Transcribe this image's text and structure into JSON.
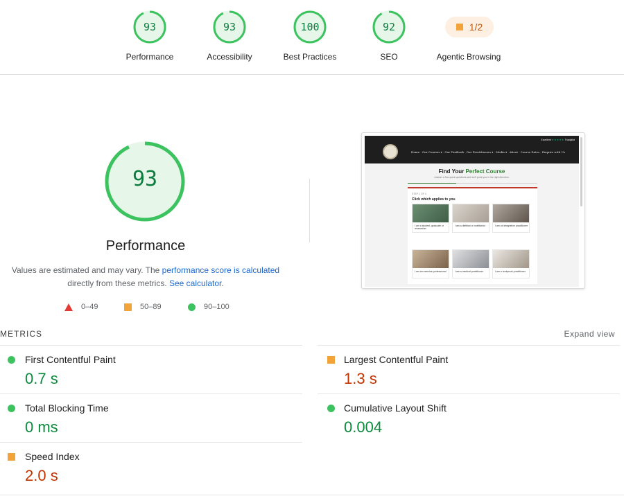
{
  "gauges": [
    {
      "score": "93",
      "label": "Performance",
      "fraction": 0.93
    },
    {
      "score": "93",
      "label": "Accessibility",
      "fraction": 0.93
    },
    {
      "score": "100",
      "label": "Best Practices",
      "fraction": 1.0
    },
    {
      "score": "92",
      "label": "SEO",
      "fraction": 0.92
    }
  ],
  "agentic": {
    "value": "1/2",
    "label": "Agentic Browsing"
  },
  "performance": {
    "score": "93",
    "fraction": 0.93,
    "title": "Performance",
    "desc_part1": "Values are estimated and may vary. The ",
    "desc_link1": "performance score is calculated",
    "desc_part2": " directly from these metrics. ",
    "desc_link2": "See calculator",
    "desc_end": "."
  },
  "legend": {
    "fail": "0–49",
    "average": "50–89",
    "pass": "90–100"
  },
  "thumbnail": {
    "nav": "Home  ·  Our Courses ▾  ·  Our Textbook  ·  Our Practitioners ▾  ·  Media ▾  ·  About  ·  Course Dates  ·  Enquire with Us",
    "trust_prefix": "Excellent ",
    "trust_stars": "★★★★★",
    "trust_suffix": " Trustpilot",
    "heading_start": "Find Your ",
    "heading_highlight": "Perfect Course",
    "subheading": "Answer a few quick questions and we'll point you in the right direction.",
    "step": "STEP 1 OF 4",
    "question": "Click which applies to you",
    "tiles": [
      "I am a student, graduate or researcher",
      "I am a dietitian or nutritionist",
      "I am an integrative practitioner",
      "I am an exercise professional",
      "I am a medical practitioner",
      "I am a bodywork practitioner"
    ]
  },
  "metrics": {
    "heading": "METRICS",
    "expand": "Expand view",
    "items": [
      {
        "name": "First Contentful Paint",
        "value": "0.7 s",
        "status": "pass"
      },
      {
        "name": "Largest Contentful Paint",
        "value": "1.3 s",
        "status": "average"
      },
      {
        "name": "Total Blocking Time",
        "value": "0 ms",
        "status": "pass"
      },
      {
        "name": "Cumulative Layout Shift",
        "value": "0.004",
        "status": "pass"
      },
      {
        "name": "Speed Index",
        "value": "2.0 s",
        "status": "average"
      }
    ]
  },
  "colors": {
    "pass": "#0c8a3e",
    "pass_ring": "#3cc35f",
    "average": "#f2a33a",
    "average_text": "#c33300",
    "fail": "#e53935",
    "link": "#1967d2"
  }
}
